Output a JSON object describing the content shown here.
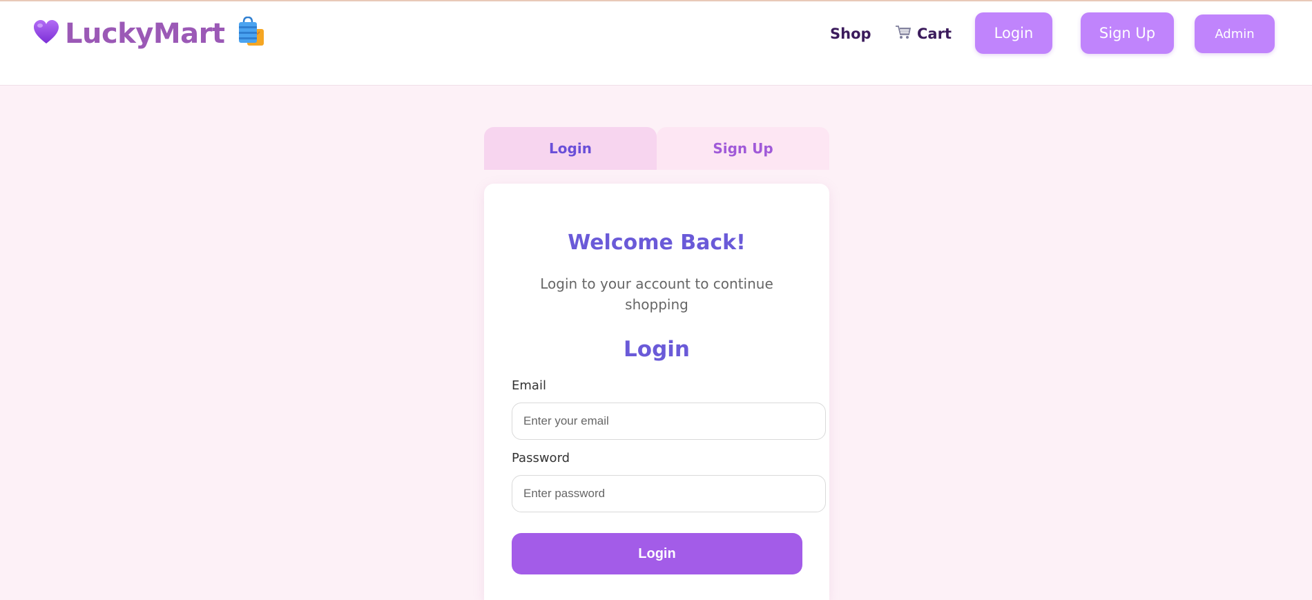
{
  "header": {
    "brand": {
      "heart_icon": "purple-heart-icon",
      "name": "LuckyMart",
      "bag_icon": "shopping-bags-icon"
    },
    "nav": {
      "shop_label": "Shop",
      "cart_icon": "cart-icon",
      "cart_label": "Cart",
      "login_label": "Login",
      "signup_label": "Sign Up",
      "admin_label": "Admin"
    }
  },
  "auth_tabs": [
    {
      "label": "Login",
      "active": true
    },
    {
      "label": "Sign Up",
      "active": false
    }
  ],
  "card": {
    "welcome_title": "Welcome Back!",
    "subtitle": "Login to your account to continue shopping",
    "form_title": "Login",
    "email": {
      "label": "Email",
      "placeholder": "Enter your email",
      "value": ""
    },
    "password": {
      "label": "Password",
      "placeholder": "Enter password",
      "value": ""
    },
    "submit_label": "Login"
  },
  "colors": {
    "brand": "#9b59b6",
    "accent_button": "#c084fc",
    "submit_button": "#a35ce8",
    "heading": "#6a5ad8",
    "page_background": "#fdf1f7"
  }
}
